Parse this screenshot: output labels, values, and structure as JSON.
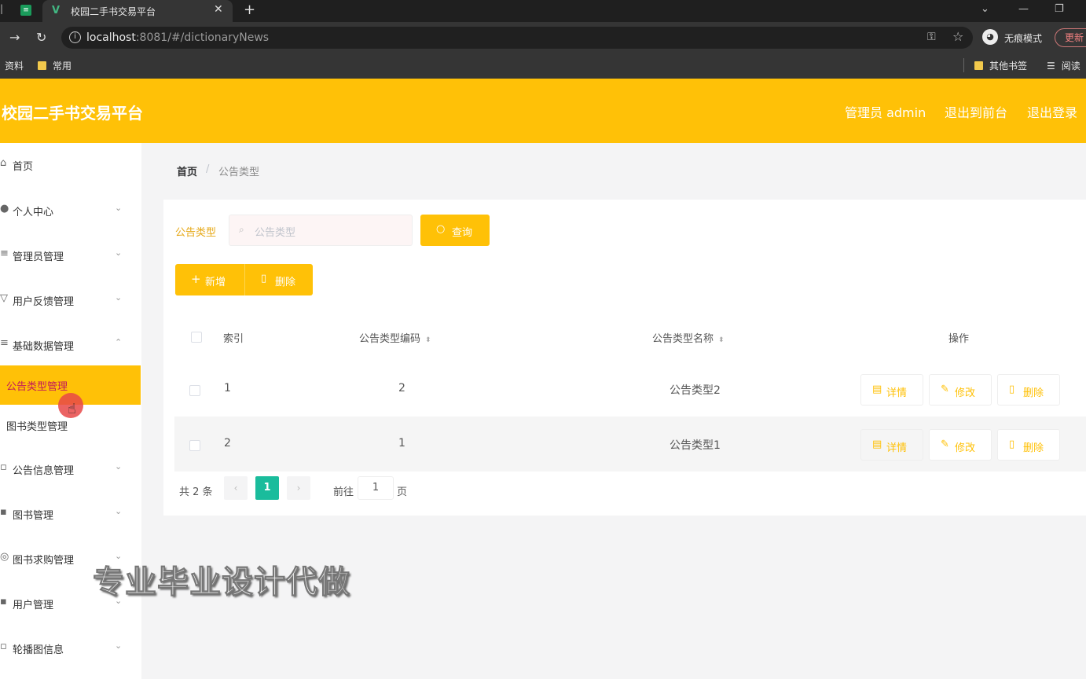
{
  "browser": {
    "tab_title": "校园二手书交易平台",
    "url_host": "localhost",
    "url_rest": ":8081/#/dictionaryNews",
    "incognito_label": "无痕模式",
    "update_label": "更新",
    "bookmarks": [
      "资料",
      "常用",
      "其他书签",
      "阅读"
    ]
  },
  "header": {
    "title": "校园二手书交易平台",
    "admin_label": "管理员 admin",
    "front_link": "退出到前台",
    "logout_link": "退出登录"
  },
  "sidebar": {
    "items": [
      {
        "label": "首页",
        "icon": "home-icon"
      },
      {
        "label": "个人中心",
        "icon": "user-icon"
      },
      {
        "label": "管理员管理",
        "icon": "list-icon"
      },
      {
        "label": "用户反馈管理",
        "icon": "feedback-icon"
      },
      {
        "label": "基础数据管理",
        "icon": "data-icon"
      },
      {
        "label": "公告信息管理",
        "icon": "notice-icon"
      },
      {
        "label": "图书管理",
        "icon": "book-icon"
      },
      {
        "label": "图书求购管理",
        "icon": "purchase-icon"
      },
      {
        "label": "用户管理",
        "icon": "users-icon"
      },
      {
        "label": "轮播图信息",
        "icon": "carousel-icon"
      }
    ],
    "submenu": [
      {
        "label": "公告类型管理",
        "active": true
      },
      {
        "label": "图书类型管理",
        "active": false
      }
    ]
  },
  "breadcrumb": {
    "home": "首页",
    "separator": "/",
    "current": "公告类型"
  },
  "search": {
    "label": "公告类型",
    "placeholder": "公告类型",
    "query_button": "查询"
  },
  "toolbar": {
    "add_button": "新增",
    "delete_button": "删除"
  },
  "table": {
    "headers": [
      "索引",
      "公告类型编码",
      "公告类型名称",
      "操作"
    ],
    "rows": [
      {
        "index": "1",
        "code": "2",
        "name": "公告类型2"
      },
      {
        "index": "2",
        "code": "1",
        "name": "公告类型1"
      }
    ],
    "actions": {
      "detail": "详情",
      "edit": "修改",
      "delete": "删除"
    }
  },
  "pagination": {
    "total": "共 2 条",
    "current_page": "1",
    "goto_label": "前往",
    "goto_value": "1",
    "page_unit": "页"
  },
  "watermark": "专业毕业设计代做",
  "colors": {
    "header": "#ffc107",
    "accent": "#ffc107",
    "active_submenu_text": "#c2185b",
    "page_active": "#1abc9c"
  }
}
